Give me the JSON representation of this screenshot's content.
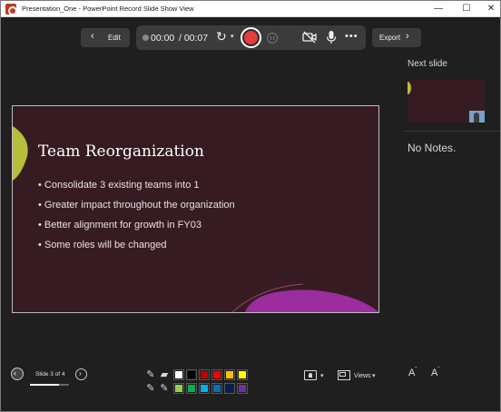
{
  "window": {
    "title": "Presentation_One - PowerPoint Record Slide Show View",
    "minimize_glyph": "—",
    "maximize_glyph": "☐",
    "close_glyph": "✕"
  },
  "toolbar": {
    "edit_label": "Edit",
    "back_glyph": "‹",
    "time_current": "00:00",
    "time_total": "/ 00:07",
    "retake_glyph": "↻",
    "caret_glyph": "▾",
    "more_glyph": "•••",
    "export_label": "Export",
    "forward_glyph": "›"
  },
  "slide": {
    "title": "Team Reorganization",
    "bullets": [
      "Consolidate 3 existing teams into 1",
      "Greater impact throughout the organization",
      "Better alignment for growth in FY03",
      "Some roles will be changed"
    ],
    "background_color": "#361c22",
    "accent_colors": [
      "#b7be3a",
      "#9b2d9e",
      "#b94a8a"
    ]
  },
  "right_pane": {
    "next_slide_label": "Next slide",
    "notes_text": "No Notes."
  },
  "bottom": {
    "prev_glyph": "‹",
    "next_glyph": "›",
    "slide_counter": "Slide 3 of 4",
    "progress": 0.75,
    "views_label": "Views",
    "caret_glyph": "▾",
    "font_letter": "A",
    "increase_font_glyph": "ˆ",
    "decrease_font_glyph": "ˇ",
    "pen_glyph": "✎",
    "eraser_glyph": "▰",
    "pen_colors_row1": [
      "#ffffff",
      "#000000",
      "#c00000",
      "#ff0000",
      "#ffc000",
      "#ffff00"
    ],
    "pen_colors_row2": [
      "#92d050",
      "#00b050",
      "#00b0f0",
      "#0070c0",
      "#002060",
      "#7030a0"
    ]
  },
  "icons": {
    "app": "powerpoint-icon",
    "camera": "camera-off-icon",
    "microphone": "microphone-icon",
    "presenter": "presenter-view-icon",
    "views": "views-icon"
  }
}
